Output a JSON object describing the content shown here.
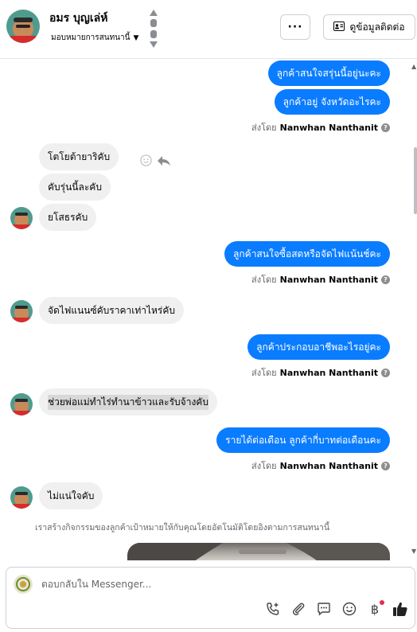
{
  "header": {
    "contact_name": "อมร บุญเล่ห์",
    "assign_label": "มอบหมายการสนทนานี้",
    "more_label": "···",
    "contact_button_label": "ดูข้อมูลติดต่อ"
  },
  "messages": [
    {
      "from": "page",
      "text": "ลูกค้าสนใจสรุ่นนี้อยู่นะคะ"
    },
    {
      "from": "page",
      "text": "ลูกค้าอยู่ จังหวัดอะไรคะ"
    },
    {
      "from": "customer",
      "text": "โตโยต้ายาริคับ"
    },
    {
      "from": "customer",
      "text": "คับรุ่นนี้ละคับ"
    },
    {
      "from": "customer",
      "text": "ยโสธรคับ"
    },
    {
      "from": "page",
      "text": "ลูกค้าสนใจซื้อสดหรือจัดไฟแน้นช์คะ"
    },
    {
      "from": "customer",
      "text": "จัดไฟแนนซ์คับราคาเท่าไหร่คับ"
    },
    {
      "from": "page",
      "text": "ลูกค้าประกอบอาชีพอะไรอยู่คะ"
    },
    {
      "from": "customer",
      "text": "ช่วยพ่อแม่ทำไร่ทำนาข้าวและรับจ้างคับ"
    },
    {
      "from": "page",
      "text": "รายได้ต่อเดือน ลูกค้ากี่บาทต่อเดือนคะ"
    },
    {
      "from": "customer",
      "text": "ไม่แน่ใจคับ"
    }
  ],
  "sent_by": {
    "prefix": "ส่งโดย",
    "name": "Nanwhan Nanthanit",
    "help": "?"
  },
  "ai_note": "เราสร้างกิจกรรมของลูกค้าเป้าหมายให้กับคุณโดยอัตโนมัติโดยอิงตามการสนทนานี้",
  "composer": {
    "placeholder": "ตอบกลับใน Messenger...",
    "tools": [
      "add-call-icon",
      "attachment-icon",
      "saved-reply-icon",
      "emoji-icon",
      "payment-icon",
      "like-icon"
    ]
  },
  "colors": {
    "outgoing_bubble": "#0a7cff",
    "incoming_bubble": "#f0f0f0",
    "notification_dot": "#f02849"
  }
}
